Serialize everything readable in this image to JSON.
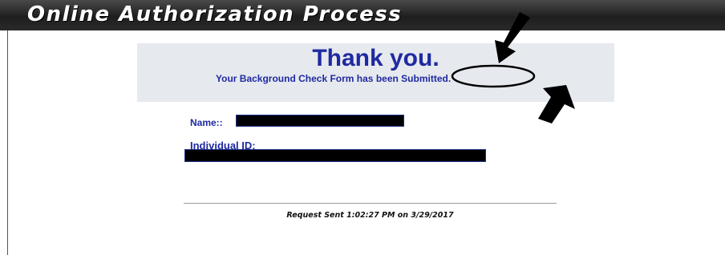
{
  "header": {
    "title": "Online Authorization Process"
  },
  "confirmation": {
    "heading": "Thank you.",
    "message": "Your Background Check Form has been Submitted."
  },
  "form": {
    "name_label": "Name::",
    "id_label": "Individual ID:"
  },
  "footer": {
    "request_sent": "Request Sent 1:02:27 PM on 3/29/2017"
  },
  "colors": {
    "header_bg": "#2a2a2a",
    "accent_text": "#1f2aa0",
    "confirmation_bg": "#e6e9ee"
  },
  "annotation_icons": [
    "arrow-down-icon",
    "arrow-up-icon",
    "highlight-ellipse"
  ]
}
